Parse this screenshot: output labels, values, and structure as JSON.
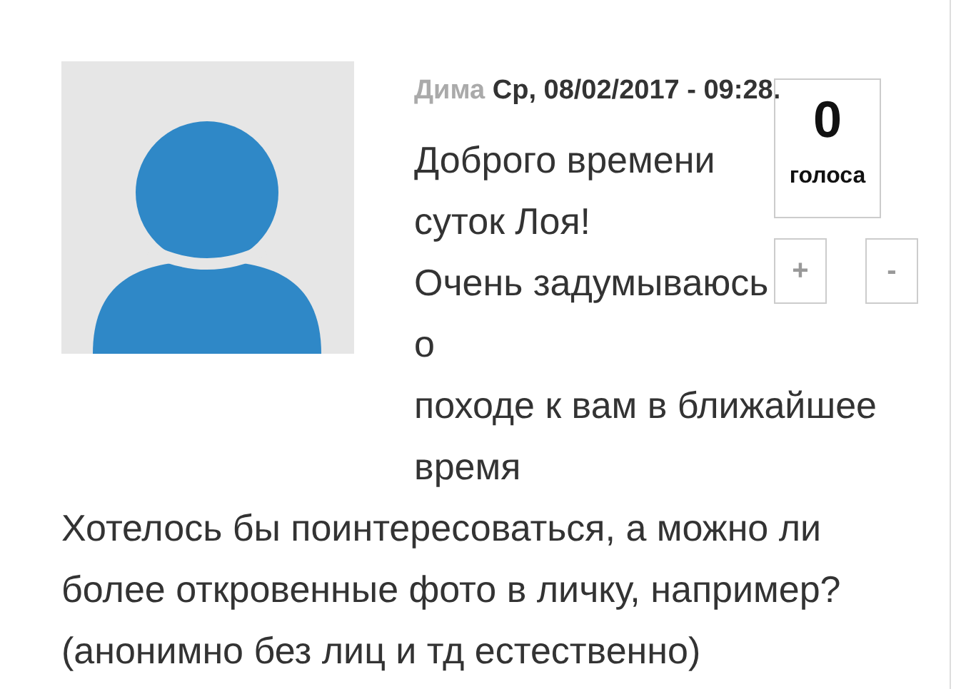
{
  "comment": {
    "author": "Дима",
    "date": "Ср, 08/02/2017 - 09:28.",
    "top_lines": [
      "Доброго времени суток Лоя!",
      "Очень задумываюсь о"
    ],
    "lines": [
      "походе к вам в ближайшее время",
      "Хотелось бы поинтересоваться, а можно ли более откровенные фото в личку, например?",
      "(анонимно без лиц и тд естественно)"
    ],
    "votes": {
      "count": "0",
      "label": "голоса",
      "buttons": [
        "+",
        "-"
      ]
    }
  }
}
